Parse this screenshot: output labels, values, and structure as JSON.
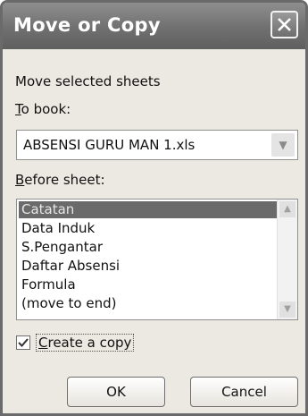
{
  "dialog": {
    "title": "Move or Copy",
    "close_icon": "close-x-icon",
    "prompt": "Move selected sheets",
    "to_book": {
      "label_access": "T",
      "label_rest": "o book:",
      "value": "ABSENSI GURU MAN 1.xls",
      "arrow_icon": "chevron-down-icon"
    },
    "before_sheet": {
      "label_access": "B",
      "label_rest": "efore sheet:",
      "items": [
        "Catatan",
        "Data Induk",
        "S.Pengantar",
        "Daftar Absensi",
        "Formula",
        "(move to end)"
      ],
      "selected": "Catatan"
    },
    "create_copy": {
      "checked": true,
      "label_access": "C",
      "label_rest": "reate a copy"
    },
    "buttons": {
      "ok": "OK",
      "cancel": "Cancel"
    },
    "accent": "#6a6a6a"
  }
}
